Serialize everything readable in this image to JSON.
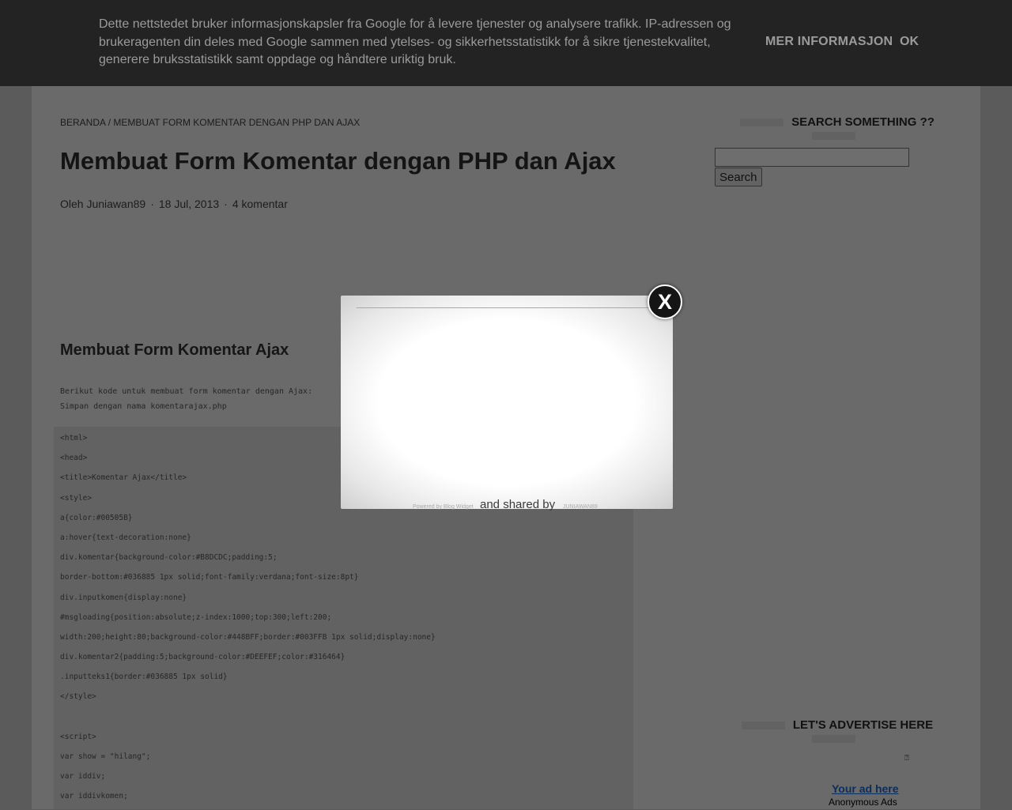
{
  "cookie_banner": {
    "message": "Dette nettstedet bruker informasjonskapsler fra Google for å levere tjenester og analysere trafikk. IP-adressen og brukeragenten din deles med Google sammen med ytelses- og sikkerhetsstatistikk for å sikre tjenestekvalitet, generere bruksstatistikk samt oppdage og håndtere uriktig bruk.",
    "more_info_label": "MER INFORMASJON",
    "ok_label": "OK"
  },
  "breadcrumb": {
    "home": "BERANDA",
    "separator": "/",
    "current": "MEMBUAT FORM KOMENTAR DENGAN PHP DAN AJAX"
  },
  "post": {
    "title": "Membuat Form Komentar dengan PHP dan Ajax",
    "author": "Oleh Juniawan89",
    "date": "18 Jul, 2013",
    "comments": "4 komentar",
    "meta_separator": "·",
    "section_heading": "Membuat Form Komentar Ajax",
    "intro_lines": [
      "Berikut kode untuk membuat form komentar dengan Ajax:",
      "Simpan dengan nama komentarajax.php"
    ],
    "code_lines": [
      "<html>",
      "<head>",
      "<title>Komentar Ajax</title>",
      "<style>",
      "a{color:#00505B}",
      "a:hover{text-decoration:none}",
      "div.komentar{background-color:#B8DCDC;padding:5;",
      "border-bottom:#036885 1px solid;font-family:verdana;font-size:8pt}",
      "div.inputkomen{display:none}",
      "#msgloading{position:absolute;z-index:1000;top:300;left:200;",
      "width:200;height:80;background-color:#448BFF;border:#003FFB 1px solid;display:none}",
      "div.komentar2{padding:5;background-color:#DEEFEF;color:#316464}",
      ".inputteks1{border:#036885 1px solid}",
      "</style>",
      "",
      "<script>",
      "var show = \"hilang\";",
      "var iddiv;",
      "var iddivkomen;"
    ]
  },
  "sidebar": {
    "search_title": "SEARCH SOMETHING ??",
    "search_button": "Search",
    "search_value": "",
    "advertise_title": "LET'S ADVERTISE HERE",
    "ad_link": "Your ad here",
    "ad_sub": "Anonymous Ads"
  },
  "modal": {
    "close_label": "X",
    "shared_text": "and shared by",
    "powered_text": "Powered by Blog Widget",
    "author_text": "JUNIAWAN89"
  }
}
